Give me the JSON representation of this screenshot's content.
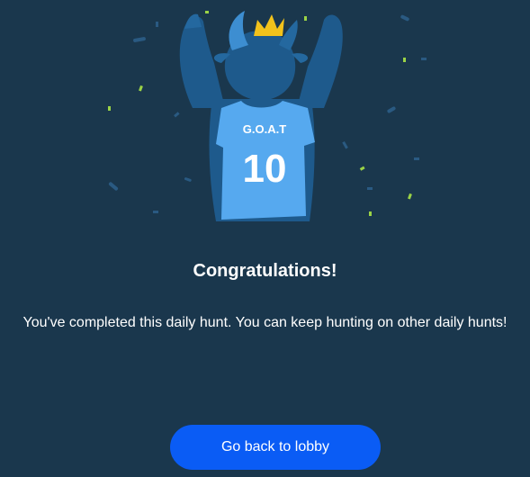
{
  "dialog": {
    "title": "Congratulations!",
    "message": "You've completed this daily hunt. You can keep hunting on other daily hunts!",
    "button_label": "Go back to lobby"
  },
  "illustration": {
    "jersey_text": "G.O.A.T",
    "jersey_number": "10",
    "icon": "goat-mascot-with-crown"
  },
  "colors": {
    "background": "#1a374d",
    "button": "#0a5cf5",
    "jersey": "#56a9ef",
    "mascot": "#1e5a8c",
    "crown": "#f2c21b",
    "confetti_green": "#9bd346"
  }
}
